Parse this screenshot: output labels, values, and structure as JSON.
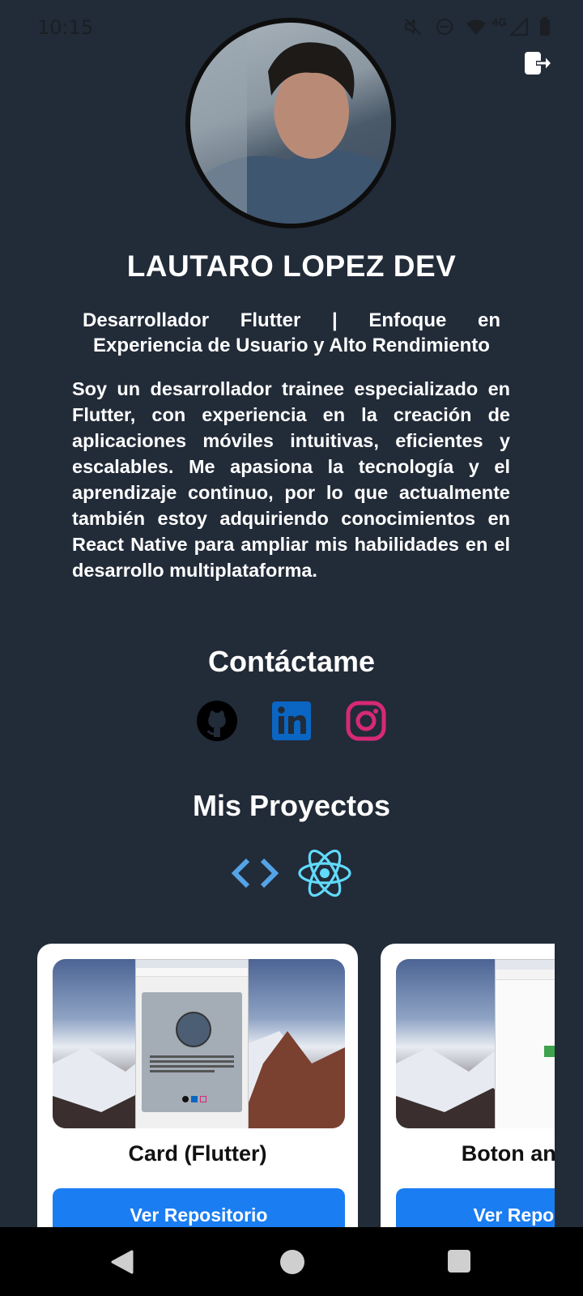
{
  "status_bar": {
    "time": "10:15",
    "network": "4G",
    "icons": [
      "mute-icon",
      "do-not-disturb-icon",
      "wifi-icon",
      "signal-icon",
      "battery-icon"
    ]
  },
  "header": {
    "logout_icon": "logout-icon"
  },
  "profile": {
    "name": "LAUTARO LOPEZ DEV",
    "tagline": "Desarrollador Flutter | Enfoque en Experiencia de Usuario y Alto Rendimiento",
    "bio": "Soy un desarrollador trainee especializado en Flutter, con experiencia en la creación de aplicaciones móviles intuitivas, eficientes y escalables. Me apasiona la tecnología y el aprendizaje continuo, por lo que actualmente también estoy adquiriendo conocimientos en React Native para ampliar mis habilidades en el desarrollo multiplataforma."
  },
  "contact": {
    "title": "Contáctame",
    "links": [
      {
        "icon": "github-icon",
        "color": "#000000"
      },
      {
        "icon": "linkedin-icon",
        "color": "#0a66c2"
      },
      {
        "icon": "instagram-icon",
        "color": "#d62976"
      }
    ]
  },
  "projects": {
    "title": "Mis Proyectos",
    "tech_icons": [
      {
        "icon": "code-icon",
        "color": "#54a3e6"
      },
      {
        "icon": "react-icon",
        "color": "#61dafb"
      }
    ],
    "cards": [
      {
        "title": "Card (Flutter)",
        "button": "Ver Repositorio"
      },
      {
        "title": "Boton animado",
        "button": "Ver Repositorio"
      }
    ]
  },
  "nav": {
    "icons": [
      "back-icon",
      "home-icon",
      "recents-icon"
    ]
  }
}
